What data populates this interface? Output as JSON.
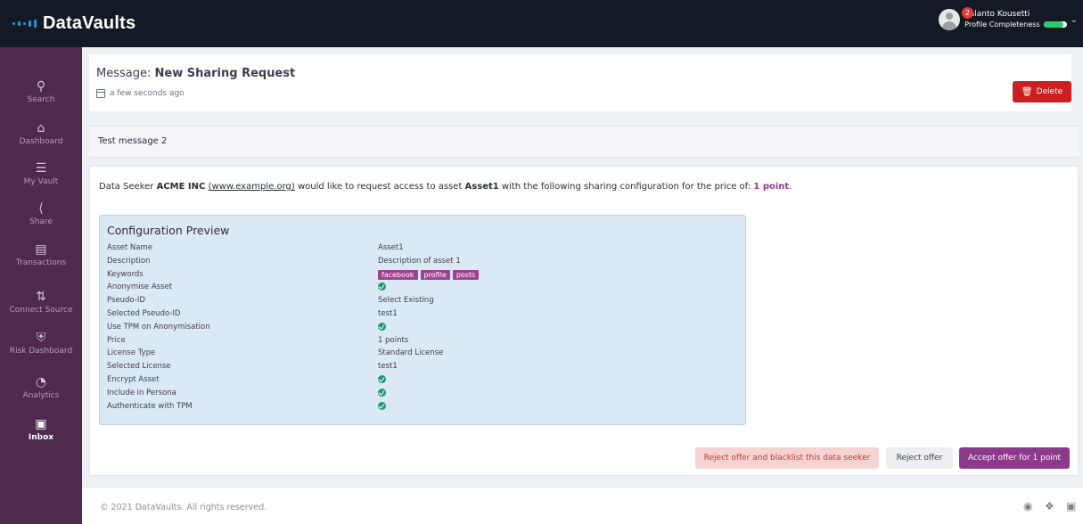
{
  "app": {
    "name": "DataVaults"
  },
  "user": {
    "name": "Valanto Kousetti",
    "subtitle": "Profile Completeness",
    "notifications": "2",
    "profile_completeness": 0.85
  },
  "sidebar": {
    "items": [
      {
        "label": "Search",
        "icon": "search-icon"
      },
      {
        "label": "Dashboard",
        "icon": "home-icon"
      },
      {
        "label": "My Vault",
        "icon": "database-icon"
      },
      {
        "label": "Share",
        "icon": "share-icon"
      },
      {
        "label": "Transactions",
        "icon": "receipt-icon"
      },
      {
        "label": "Connect Source",
        "icon": "sliders-icon"
      },
      {
        "label": "Risk Dashboard",
        "icon": "shield-icon"
      },
      {
        "label": "Analytics",
        "icon": "pie-chart-icon"
      },
      {
        "label": "Inbox",
        "icon": "inbox-icon"
      }
    ],
    "active": "Inbox"
  },
  "message": {
    "title_prefix": "Message:",
    "title": "New Sharing Request",
    "time": "a few seconds ago",
    "delete_label": "Delete",
    "subject": "Test message 2"
  },
  "request": {
    "part1": "Data Seeker ",
    "seeker": "ACME INC",
    "website": "(www.example.org)",
    "part2": " would like to request access to asset ",
    "asset": "Asset1",
    "part3": " with the following sharing configuration for the price of: ",
    "price": "1 point",
    "part4": "."
  },
  "config": {
    "title": "Configuration Preview",
    "rows": [
      {
        "label": "Asset Name",
        "type": "text",
        "value": "Asset1"
      },
      {
        "label": "Description",
        "type": "text",
        "value": "Description of asset 1"
      },
      {
        "label": "Keywords",
        "type": "tags",
        "value": [
          "facebook",
          "profile",
          "posts"
        ]
      },
      {
        "label": "Anonymise Asset",
        "type": "check",
        "value": true
      },
      {
        "label": "Pseudo-ID",
        "type": "text",
        "value": "Select Existing"
      },
      {
        "label": "Selected Pseudo-ID",
        "type": "text",
        "value": "test1"
      },
      {
        "label": "Use TPM on Anonymisation",
        "type": "check",
        "value": true
      },
      {
        "label": "Price",
        "type": "text",
        "value": "1 points"
      },
      {
        "label": "License Type",
        "type": "text",
        "value": "Standard License"
      },
      {
        "label": "Selected License",
        "type": "text",
        "value": "test1"
      },
      {
        "label": "Encrypt Asset",
        "type": "check",
        "value": true
      },
      {
        "label": "Include in Persona",
        "type": "check",
        "value": true
      },
      {
        "label": "Authenticate with TPM",
        "type": "check",
        "value": true
      }
    ]
  },
  "actions": {
    "blacklist": "Reject offer and blacklist this data seeker",
    "reject": "Reject offer",
    "accept": "Accept offer for 1 point"
  },
  "footer": {
    "copyright": "© 2021 DataVaults. All rights reserved.",
    "social": [
      "github-icon",
      "twitter-icon",
      "linkedin-icon"
    ]
  },
  "colors": {
    "sidebar": "#4e2a4e",
    "accent": "#8c3a8a",
    "danger": "#cc1f1f",
    "success": "#1d9b6c"
  }
}
